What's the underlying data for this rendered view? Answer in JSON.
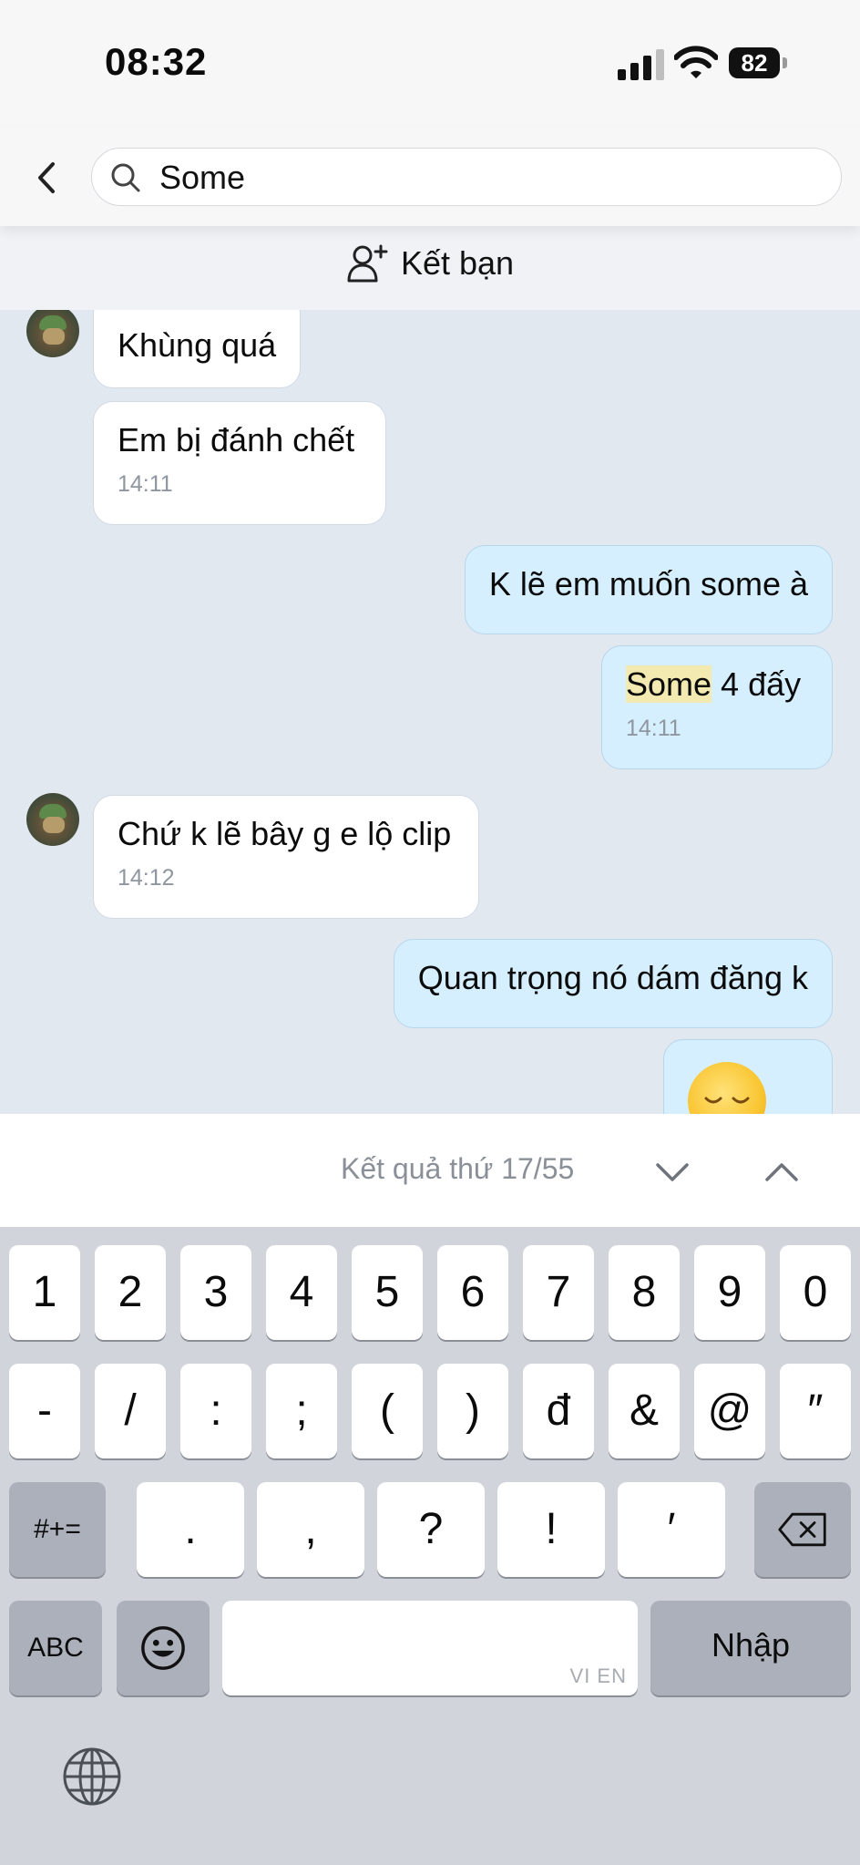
{
  "status_bar": {
    "time": "08:32",
    "battery": "82"
  },
  "search": {
    "value": "Some"
  },
  "friend_bar": {
    "label": "Kết bạn"
  },
  "messages": [
    {
      "text": "Khùng quá"
    },
    {
      "text": "Em bị đánh chết",
      "time": "14:11"
    },
    {
      "text": "K lẽ em muốn some à"
    },
    {
      "highlight": "Some",
      "rest": " 4 đấy",
      "time": "14:11"
    },
    {
      "text": "Chứ k lẽ bây g e lộ clip",
      "time": "14:12"
    },
    {
      "text": "Quan trọng nó dám đăng k"
    }
  ],
  "search_results": {
    "label": "Kết quả thứ 17/55"
  },
  "keyboard": {
    "row1": [
      "1",
      "2",
      "3",
      "4",
      "5",
      "6",
      "7",
      "8",
      "9",
      "0"
    ],
    "row2": [
      "-",
      "/",
      ":",
      ";",
      "(",
      ")",
      "đ",
      "&",
      "@",
      "″"
    ],
    "row3": [
      ".",
      ",",
      "?",
      "!",
      "′"
    ],
    "symbols_label": "#+=",
    "abc_label": "ABC",
    "return_label": "Nhập",
    "space_hint": "VI EN"
  },
  "icons": [
    "back-chevron-icon",
    "search-icon",
    "add-friend-icon",
    "emoji-icon",
    "down-chevron-icon",
    "up-chevron-icon",
    "backspace-icon",
    "emoji-keyboard-icon",
    "globe-icon"
  ]
}
